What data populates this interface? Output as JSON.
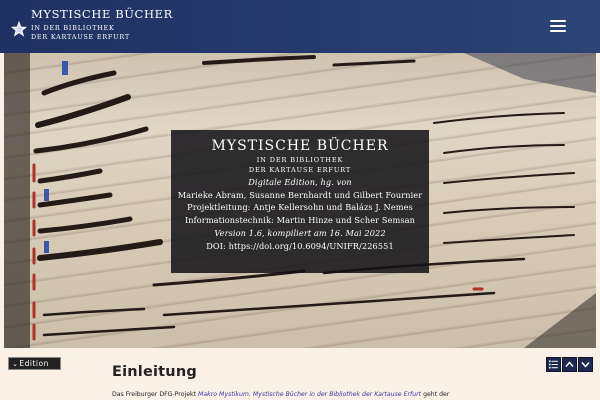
{
  "header": {
    "title": "MYSTISCHE BÜCHER",
    "subtitle_line1": "IN DER BIBLIOTHEK",
    "subtitle_line2": "DER KARTAUSE ERFURT",
    "menu_icon": "hamburger-icon",
    "logo_icon": "star-logo-icon"
  },
  "hero": {
    "title": "MYSTISCHE BÜCHER",
    "subtitle_line1": "IN DER BIBLIOTHEK",
    "subtitle_line2": "DER KARTAUSE ERFURT",
    "edition_line": "Digitale Edition, hg. von",
    "editors": "Marieke Abram, Susanne Bernhardt und Gilbert Fournier",
    "project_lead": "Projektleitung: Antje Kellersohn und Balázs J. Nemes",
    "it_credits": "Informationstechnik: Martin Hinze und Scher Semsan",
    "version": "Version 1.6, kompiliert am 16. Mai 2022",
    "doi": "DOI: https://doi.org/10.6094/UNIFR/226551"
  },
  "toolbar": {
    "edition_label": "Edition",
    "edition_icon": "chevron-down-icon",
    "toc_icon": "list-icon",
    "up_icon": "chevron-up-icon",
    "down_icon": "chevron-down-icon"
  },
  "content": {
    "section_title": "Einleitung",
    "intro_prefix": "Das Freiburger DFG-Projekt",
    "intro_link": "Makro Mystikum. Mystische Bücher in der Bibliothek der Kartause Erfurt",
    "intro_suffix": "geht der"
  },
  "colors": {
    "header_bg": "#24396d",
    "page_bg": "#faf0e6",
    "overlay_bg": "#121216",
    "nav_button_bg": "#1d2a4d",
    "link": "#3a3aa6"
  }
}
